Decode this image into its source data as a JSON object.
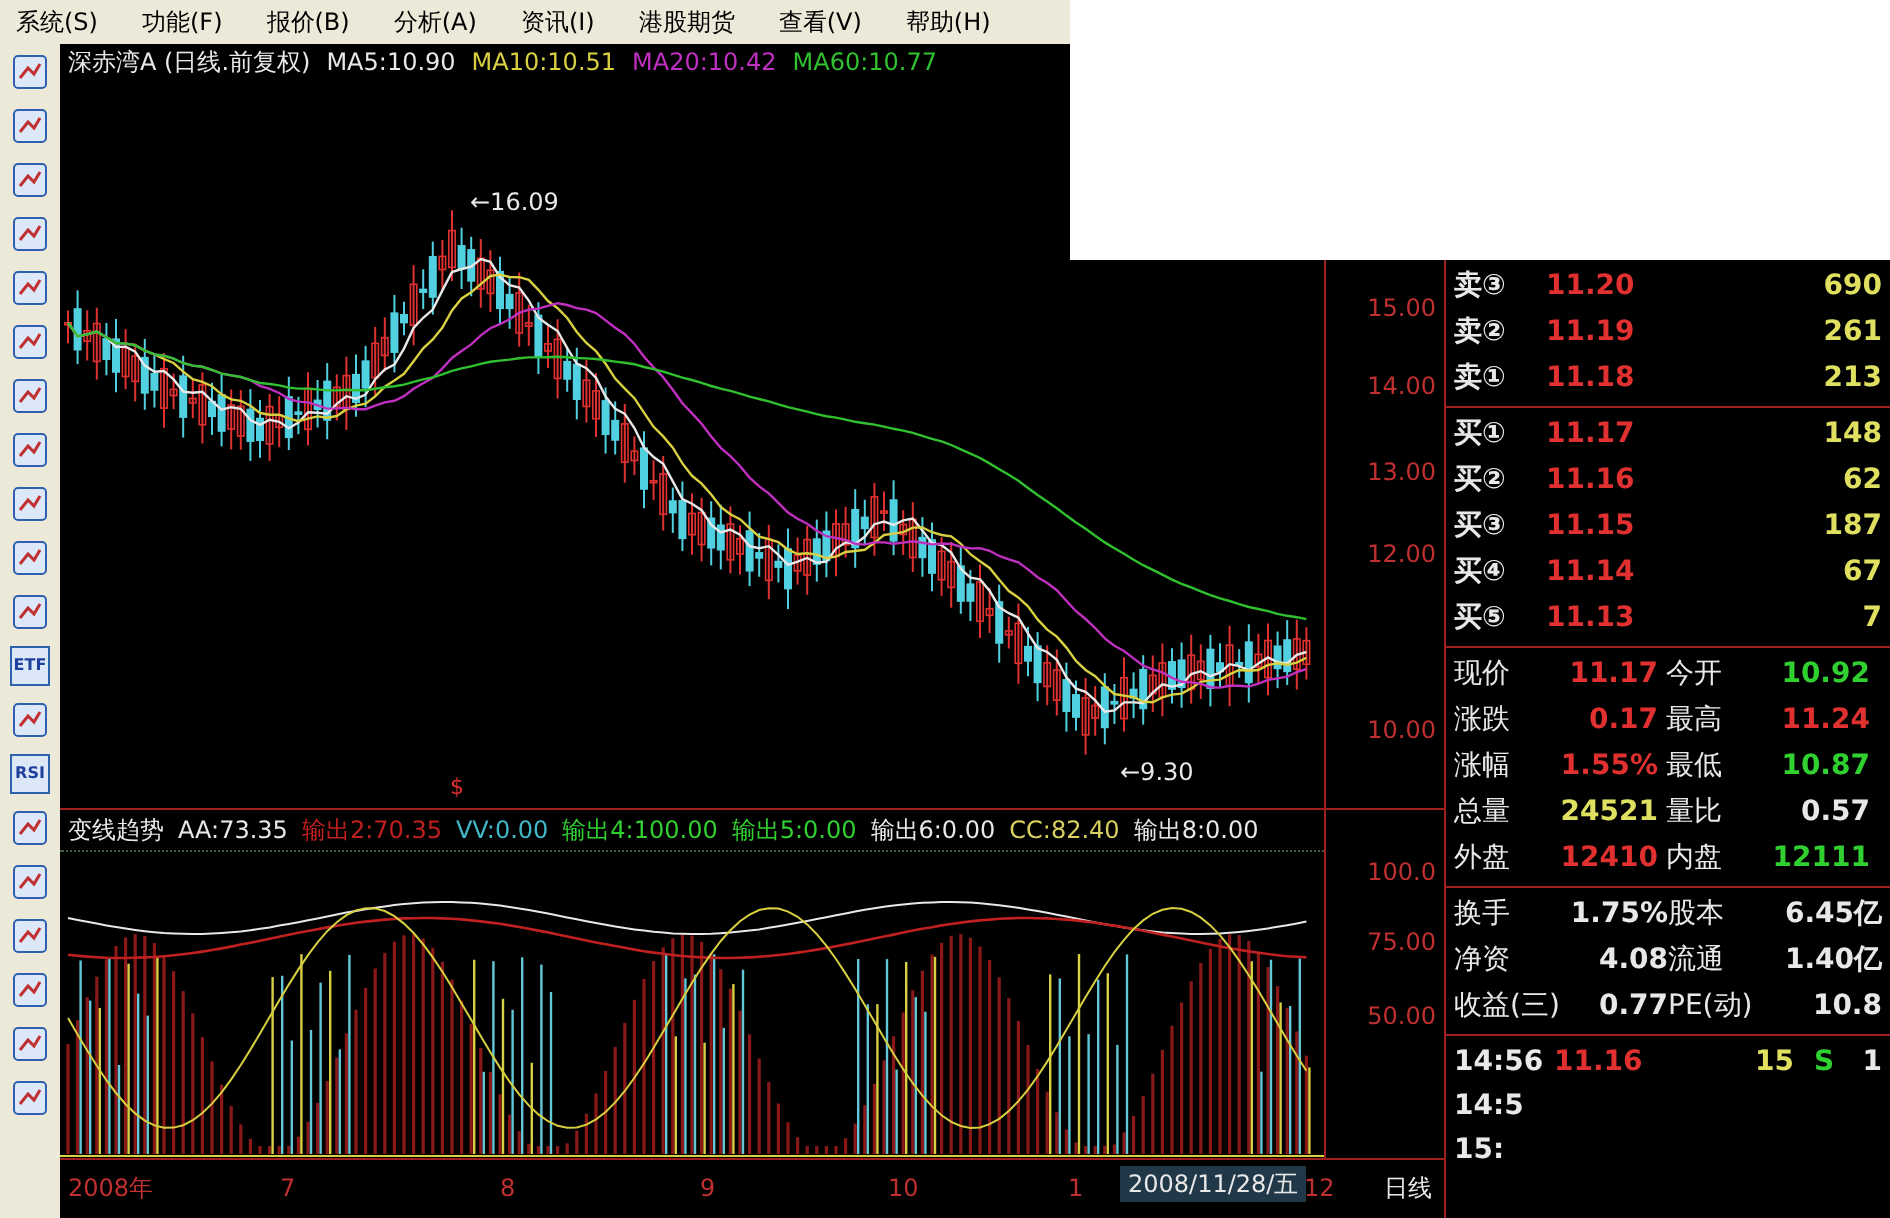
{
  "menu": [
    "系统(S)",
    "功能(F)",
    "报价(B)",
    "分析(A)",
    "资讯(I)",
    "港股期货",
    "查看(V)",
    "帮助(H)"
  ],
  "toolbar_labels": [
    "ETF",
    "RSI"
  ],
  "price_chart": {
    "title": "深赤湾A (日线.前复权)",
    "legend": [
      {
        "text": "MA5:10.90",
        "color": "#e8e8e8"
      },
      {
        "text": "MA10:10.51",
        "color": "#d8d040"
      },
      {
        "text": "MA20:10.42",
        "color": "#c030c0"
      },
      {
        "text": "MA60:10.77",
        "color": "#30c030"
      }
    ],
    "high_label": "←16.09",
    "low_label": "←9.30",
    "signal_marker": "$",
    "yticks": [
      "15.00",
      "14.00",
      "13.00",
      "12.00",
      "10.00"
    ]
  },
  "indicator": {
    "legend": [
      {
        "text": "变线趋势",
        "color": "#e8e8e8"
      },
      {
        "text": "AA:73.35",
        "color": "#e8e8e8"
      },
      {
        "text": "输出2:70.35",
        "color": "#c02020"
      },
      {
        "text": "VV:0.00",
        "color": "#40b8c8"
      },
      {
        "text": "输出4:100.00",
        "color": "#30d030"
      },
      {
        "text": "输出5:0.00",
        "color": "#30d030"
      },
      {
        "text": "输出6:0.00",
        "color": "#e8e8e8"
      },
      {
        "text": "CC:82.40",
        "color": "#d8d060"
      },
      {
        "text": "输出8:0.00",
        "color": "#e8e8e8"
      }
    ],
    "yticks": [
      "100.0",
      "75.00",
      "50.00"
    ]
  },
  "x_axis": {
    "labels": [
      "2008年",
      "7",
      "8",
      "9",
      "10",
      "1",
      "12"
    ],
    "cursor_date": "2008/11/28/五",
    "period": "日线"
  },
  "quote": {
    "asks": [
      {
        "label": "卖③",
        "price": "11.20",
        "volume": "690"
      },
      {
        "label": "卖②",
        "price": "11.19",
        "volume": "261"
      },
      {
        "label": "卖①",
        "price": "11.18",
        "volume": "213"
      }
    ],
    "bids": [
      {
        "label": "买①",
        "price": "11.17",
        "volume": "148"
      },
      {
        "label": "买②",
        "price": "11.16",
        "volume": "62"
      },
      {
        "label": "买③",
        "price": "11.15",
        "volume": "187"
      },
      {
        "label": "买④",
        "price": "11.14",
        "volume": "67"
      },
      {
        "label": "买⑤",
        "price": "11.13",
        "volume": "7"
      }
    ],
    "stats": [
      [
        {
          "label": "现价",
          "value": "11.17",
          "color": "#e03030"
        },
        {
          "label": "今开",
          "value": "10.92",
          "color": "#30d030"
        }
      ],
      [
        {
          "label": "涨跌",
          "value": "0.17",
          "color": "#e03030"
        },
        {
          "label": "最高",
          "value": "11.24",
          "color": "#e03030"
        }
      ],
      [
        {
          "label": "涨幅",
          "value": "1.55%",
          "color": "#e03030"
        },
        {
          "label": "最低",
          "value": "10.87",
          "color": "#30d030"
        }
      ],
      [
        {
          "label": "总量",
          "value": "24521",
          "color": "#e0e060"
        },
        {
          "label": "量比",
          "value": "0.57",
          "color": "#e8e8e8"
        }
      ],
      [
        {
          "label": "外盘",
          "value": "12410",
          "color": "#e03030"
        },
        {
          "label": "内盘",
          "value": "12111",
          "color": "#30d030"
        }
      ]
    ],
    "fundamentals": [
      [
        {
          "label": "换手",
          "value": "1.75%"
        },
        {
          "label": "股本",
          "value": "6.45亿"
        }
      ],
      [
        {
          "label": "净资",
          "value": "4.08"
        },
        {
          "label": "流通",
          "value": "1.40亿"
        }
      ],
      [
        {
          "label": "收益(三)",
          "value": "0.77"
        },
        {
          "label": "PE(动)",
          "value": "10.8"
        }
      ]
    ],
    "ticks": [
      {
        "time": "14:56",
        "price": "11.16",
        "volume": "15",
        "side": "S",
        "count": "1"
      },
      {
        "time": "14:5"
      },
      {
        "time": "15:"
      }
    ]
  }
}
